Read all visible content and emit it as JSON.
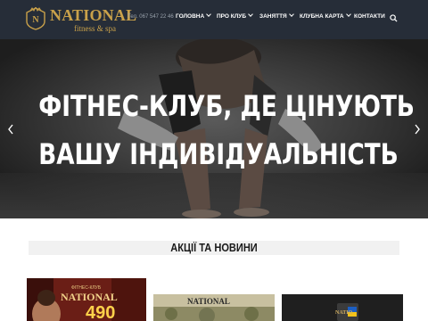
{
  "header": {
    "logo": {
      "name": "NATIONAL",
      "sub": "fitness & spa"
    },
    "phone": "Тел. 067 547 22 46",
    "nav": [
      {
        "label": "ГОЛОВНА",
        "dropdown": true
      },
      {
        "label": "ПРО КЛУБ",
        "dropdown": true
      },
      {
        "label": "ЗАНЯТТЯ",
        "dropdown": true
      },
      {
        "label": "КЛУБНА КАРТА",
        "dropdown": true
      },
      {
        "label": "КОНТАКТИ",
        "dropdown": false
      }
    ],
    "search_icon": "search-icon"
  },
  "hero": {
    "line1": "ФІТНЕС-КЛУБ, ДЕ ЦІНУЮТЬ",
    "line2": "ВАШУ ІНДИВІДУАЛЬНІСТЬ",
    "prev_icon": "chevron-left-icon",
    "next_icon": "chevron-right-icon"
  },
  "news": {
    "title": "АКЦІЇ ТА НОВИНИ",
    "cards": [
      {
        "kicker": "ФІТНЕС-КЛУБ",
        "brand": "NATIONAL",
        "number": "490"
      },
      {
        "brand": "NATIONAL"
      },
      {
        "brand": "NATIO"
      }
    ]
  },
  "colors": {
    "header_bg": "#262d38",
    "gold": "#c9a14a"
  }
}
